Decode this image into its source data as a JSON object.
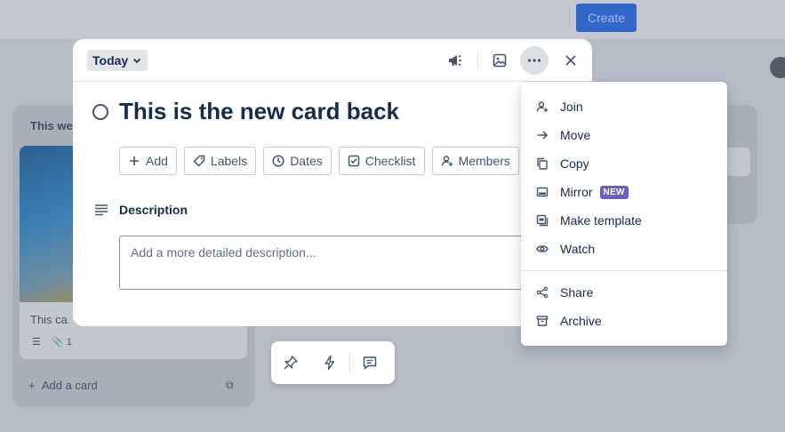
{
  "background": {
    "create_label": "Create",
    "list_title": "This we",
    "card_text": "This ca",
    "card_attachment_count": "1",
    "add_card_label": "Add a card"
  },
  "modal": {
    "date_chip": "Today",
    "title": "This is the new card back",
    "actions": [
      {
        "label": "Add",
        "icon": "plus-icon"
      },
      {
        "label": "Labels",
        "icon": "tag-icon"
      },
      {
        "label": "Dates",
        "icon": "clock-icon"
      },
      {
        "label": "Checklist",
        "icon": "checkbox-icon"
      },
      {
        "label": "Members",
        "icon": "add-person-icon"
      }
    ],
    "description_label": "Description",
    "description_placeholder": "Add a more detailed description..."
  },
  "menu": {
    "items": [
      {
        "label": "Join",
        "icon": "add-person-icon"
      },
      {
        "label": "Move",
        "icon": "arrow-right-icon"
      },
      {
        "label": "Copy",
        "icon": "copy-icon"
      },
      {
        "label": "Mirror",
        "icon": "mirror-icon",
        "badge": "NEW"
      },
      {
        "label": "Make template",
        "icon": "template-icon"
      },
      {
        "label": "Watch",
        "icon": "eye-icon"
      },
      {
        "label": "Share",
        "icon": "share-icon"
      },
      {
        "label": "Archive",
        "icon": "archive-icon"
      }
    ]
  },
  "colors": {
    "accent": "#3266c9",
    "new_badge": "#6e5dc6"
  }
}
